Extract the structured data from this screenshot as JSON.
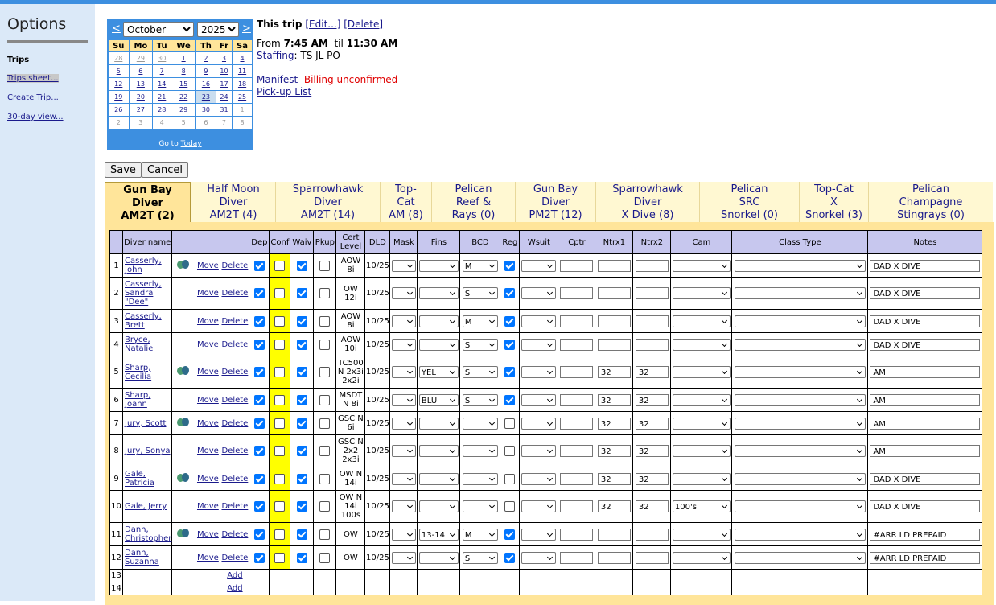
{
  "sidebar": {
    "title": "Options",
    "section": "Trips",
    "links": [
      "Trips sheet...",
      "Create Trip...",
      "30-day view..."
    ]
  },
  "calendar": {
    "prev": "<",
    "next": ">",
    "month": "October",
    "year": "2025",
    "days": [
      "Su",
      "Mo",
      "Tu",
      "We",
      "Th",
      "Fr",
      "Sa"
    ],
    "weeks": [
      [
        "28",
        "29",
        "30",
        "1",
        "2",
        "3",
        "4"
      ],
      [
        "5",
        "6",
        "7",
        "8",
        "9",
        "10",
        "11"
      ],
      [
        "12",
        "13",
        "14",
        "15",
        "16",
        "17",
        "18"
      ],
      [
        "19",
        "20",
        "21",
        "22",
        "23",
        "24",
        "25"
      ],
      [
        "26",
        "27",
        "28",
        "29",
        "30",
        "31",
        "1"
      ],
      [
        "2",
        "3",
        "4",
        "5",
        "6",
        "7",
        "8"
      ]
    ],
    "goto_prefix": "Go to",
    "goto_link": "Today"
  },
  "trip": {
    "title": "This trip",
    "edit": "[Edit...]",
    "delete": "[Delete]",
    "from_label": "From",
    "from_time": "7:45 AM",
    "til_label": "til",
    "til_time": "11:30 AM",
    "staffing_link": "Staffing",
    "staffing_value": ": TS JL PO",
    "manifest_link": "Manifest",
    "billing": "Billing unconfirmed",
    "pickup_link": "Pick-up List"
  },
  "buttons": {
    "save": "Save",
    "cancel": "Cancel"
  },
  "tabs": [
    {
      "lines": [
        "Gun Bay",
        "Diver",
        "AM2T (2)"
      ]
    },
    {
      "lines": [
        "Half Moon",
        "Diver",
        "AM2T (4)"
      ]
    },
    {
      "lines": [
        "Sparrowhawk",
        "Diver",
        "AM2T (14)"
      ]
    },
    {
      "lines": [
        "Top-",
        "Cat",
        "AM (8)"
      ]
    },
    {
      "lines": [
        "Pelican",
        "Reef &",
        "Rays (0)"
      ]
    },
    {
      "lines": [
        "Gun Bay",
        "Diver",
        "PM2T (12)"
      ]
    },
    {
      "lines": [
        "Sparrowhawk",
        "Diver",
        "X Dive (8)"
      ]
    },
    {
      "lines": [
        "Pelican",
        "SRC",
        "Snorkel (0)"
      ]
    },
    {
      "lines": [
        "Top-Cat",
        "X",
        "Snorkel (3)"
      ]
    },
    {
      "lines": [
        "Pelican",
        "Champagne",
        "Stingrays (0)"
      ]
    }
  ],
  "columns": [
    "",
    "Diver name",
    "",
    "",
    "",
    "Dep",
    "Conf",
    "Waiv",
    "Pkup",
    "Cert Level",
    "DLD",
    "Mask",
    "Fins",
    "BCD",
    "Reg",
    "Wsuit",
    "Cptr",
    "Ntrx1",
    "Ntrx2",
    "Cam",
    "Class Type",
    "Notes"
  ],
  "links": {
    "move": "Move",
    "delete": "Delete",
    "add": "Add"
  },
  "rows": [
    {
      "num": "1",
      "name": "Casserly, John",
      "icon": true,
      "dep": true,
      "conf": false,
      "waiv": true,
      "pkup": false,
      "cert": "AOW 8i",
      "dld": "10/25",
      "fins": "",
      "bcd": "M",
      "reg": true,
      "ntrx1": "",
      "ntrx2": "",
      "cam": "",
      "notes": "DAD X DIVE"
    },
    {
      "num": "2",
      "name": "Casserly, Sandra \"Dee\"",
      "icon": false,
      "dep": true,
      "conf": false,
      "waiv": true,
      "pkup": false,
      "cert": "OW 12i",
      "dld": "10/25",
      "fins": "",
      "bcd": "S",
      "reg": true,
      "ntrx1": "",
      "ntrx2": "",
      "cam": "",
      "notes": "DAD X DIVE"
    },
    {
      "num": "3",
      "name": "Casserly, Brett",
      "icon": false,
      "dep": true,
      "conf": false,
      "waiv": true,
      "pkup": false,
      "cert": "AOW 8i",
      "dld": "10/25",
      "fins": "",
      "bcd": "M",
      "reg": true,
      "ntrx1": "",
      "ntrx2": "",
      "cam": "",
      "notes": "DAD X DIVE"
    },
    {
      "num": "4",
      "name": "Bryce, Natalie",
      "icon": false,
      "dep": true,
      "conf": false,
      "waiv": true,
      "pkup": false,
      "cert": "AOW 10i",
      "dld": "10/25",
      "fins": "",
      "bcd": "S",
      "reg": true,
      "ntrx1": "",
      "ntrx2": "",
      "cam": "",
      "notes": "DAD X DIVE"
    },
    {
      "num": "5",
      "name": "Sharp, Cecilia",
      "icon": true,
      "dep": true,
      "conf": false,
      "waiv": true,
      "pkup": false,
      "cert": "TC500 N 2x3i 2x2i",
      "dld": "10/25",
      "fins": "YEL",
      "bcd": "S",
      "reg": true,
      "ntrx1": "32",
      "ntrx2": "32",
      "cam": "",
      "notes": "AM"
    },
    {
      "num": "6",
      "name": "Sharp, Joann",
      "icon": false,
      "dep": true,
      "conf": false,
      "waiv": true,
      "pkup": false,
      "cert": "MSDT N 8i",
      "dld": "10/25",
      "fins": "BLU",
      "bcd": "S",
      "reg": true,
      "ntrx1": "32",
      "ntrx2": "32",
      "cam": "",
      "notes": "AM"
    },
    {
      "num": "7",
      "name": "Jury, Scott",
      "icon": true,
      "dep": true,
      "conf": false,
      "waiv": true,
      "pkup": false,
      "cert": "GSC N 6i",
      "dld": "10/25",
      "fins": "",
      "bcd": "",
      "reg": false,
      "ntrx1": "32",
      "ntrx2": "32",
      "cam": "",
      "notes": "AM"
    },
    {
      "num": "8",
      "name": "Jury, Sonya",
      "icon": false,
      "dep": true,
      "conf": false,
      "waiv": true,
      "pkup": false,
      "cert": "GSC N 2x2 2x3i",
      "dld": "10/25",
      "fins": "",
      "bcd": "",
      "reg": false,
      "ntrx1": "32",
      "ntrx2": "32",
      "cam": "",
      "notes": "AM"
    },
    {
      "num": "9",
      "name": "Gale, Patricia",
      "icon": true,
      "dep": true,
      "conf": false,
      "waiv": true,
      "pkup": false,
      "cert": "OW N 14i",
      "dld": "10/25",
      "fins": "",
      "bcd": "",
      "reg": false,
      "ntrx1": "32",
      "ntrx2": "32",
      "cam": "",
      "notes": "DAD X DIVE"
    },
    {
      "num": "10",
      "name": "Gale, Jerry",
      "icon": false,
      "dep": true,
      "conf": false,
      "waiv": true,
      "pkup": false,
      "cert": "OW N 14i 100s",
      "dld": "10/25",
      "fins": "",
      "bcd": "",
      "reg": false,
      "ntrx1": "32",
      "ntrx2": "32",
      "cam": "100's",
      "notes": "DAD X DIVE"
    },
    {
      "num": "11",
      "name": "Dann, Christopher",
      "icon": true,
      "dep": true,
      "conf": false,
      "waiv": true,
      "pkup": false,
      "cert": "OW",
      "dld": "10/25",
      "fins": "13-14",
      "bcd": "M",
      "reg": true,
      "ntrx1": "",
      "ntrx2": "",
      "cam": "",
      "notes": "#ARR LD PREPAID"
    },
    {
      "num": "12",
      "name": "Dann, Suzanna",
      "icon": false,
      "dep": true,
      "conf": false,
      "waiv": true,
      "pkup": false,
      "cert": "OW",
      "dld": "10/25",
      "fins": "",
      "bcd": "S",
      "reg": true,
      "ntrx1": "",
      "ntrx2": "",
      "cam": "",
      "notes": "#ARR LD PREPAID"
    }
  ],
  "empty_rows": [
    "13",
    "14"
  ],
  "colors": {
    "accent": "#3d8fe0",
    "sidebar": "#dbe9f8",
    "tab_active": "#ffe59a",
    "tab_bg": "#fff8d2",
    "header": "#c7c7ee",
    "conf": "#ffff00",
    "billing": "#e00000"
  }
}
